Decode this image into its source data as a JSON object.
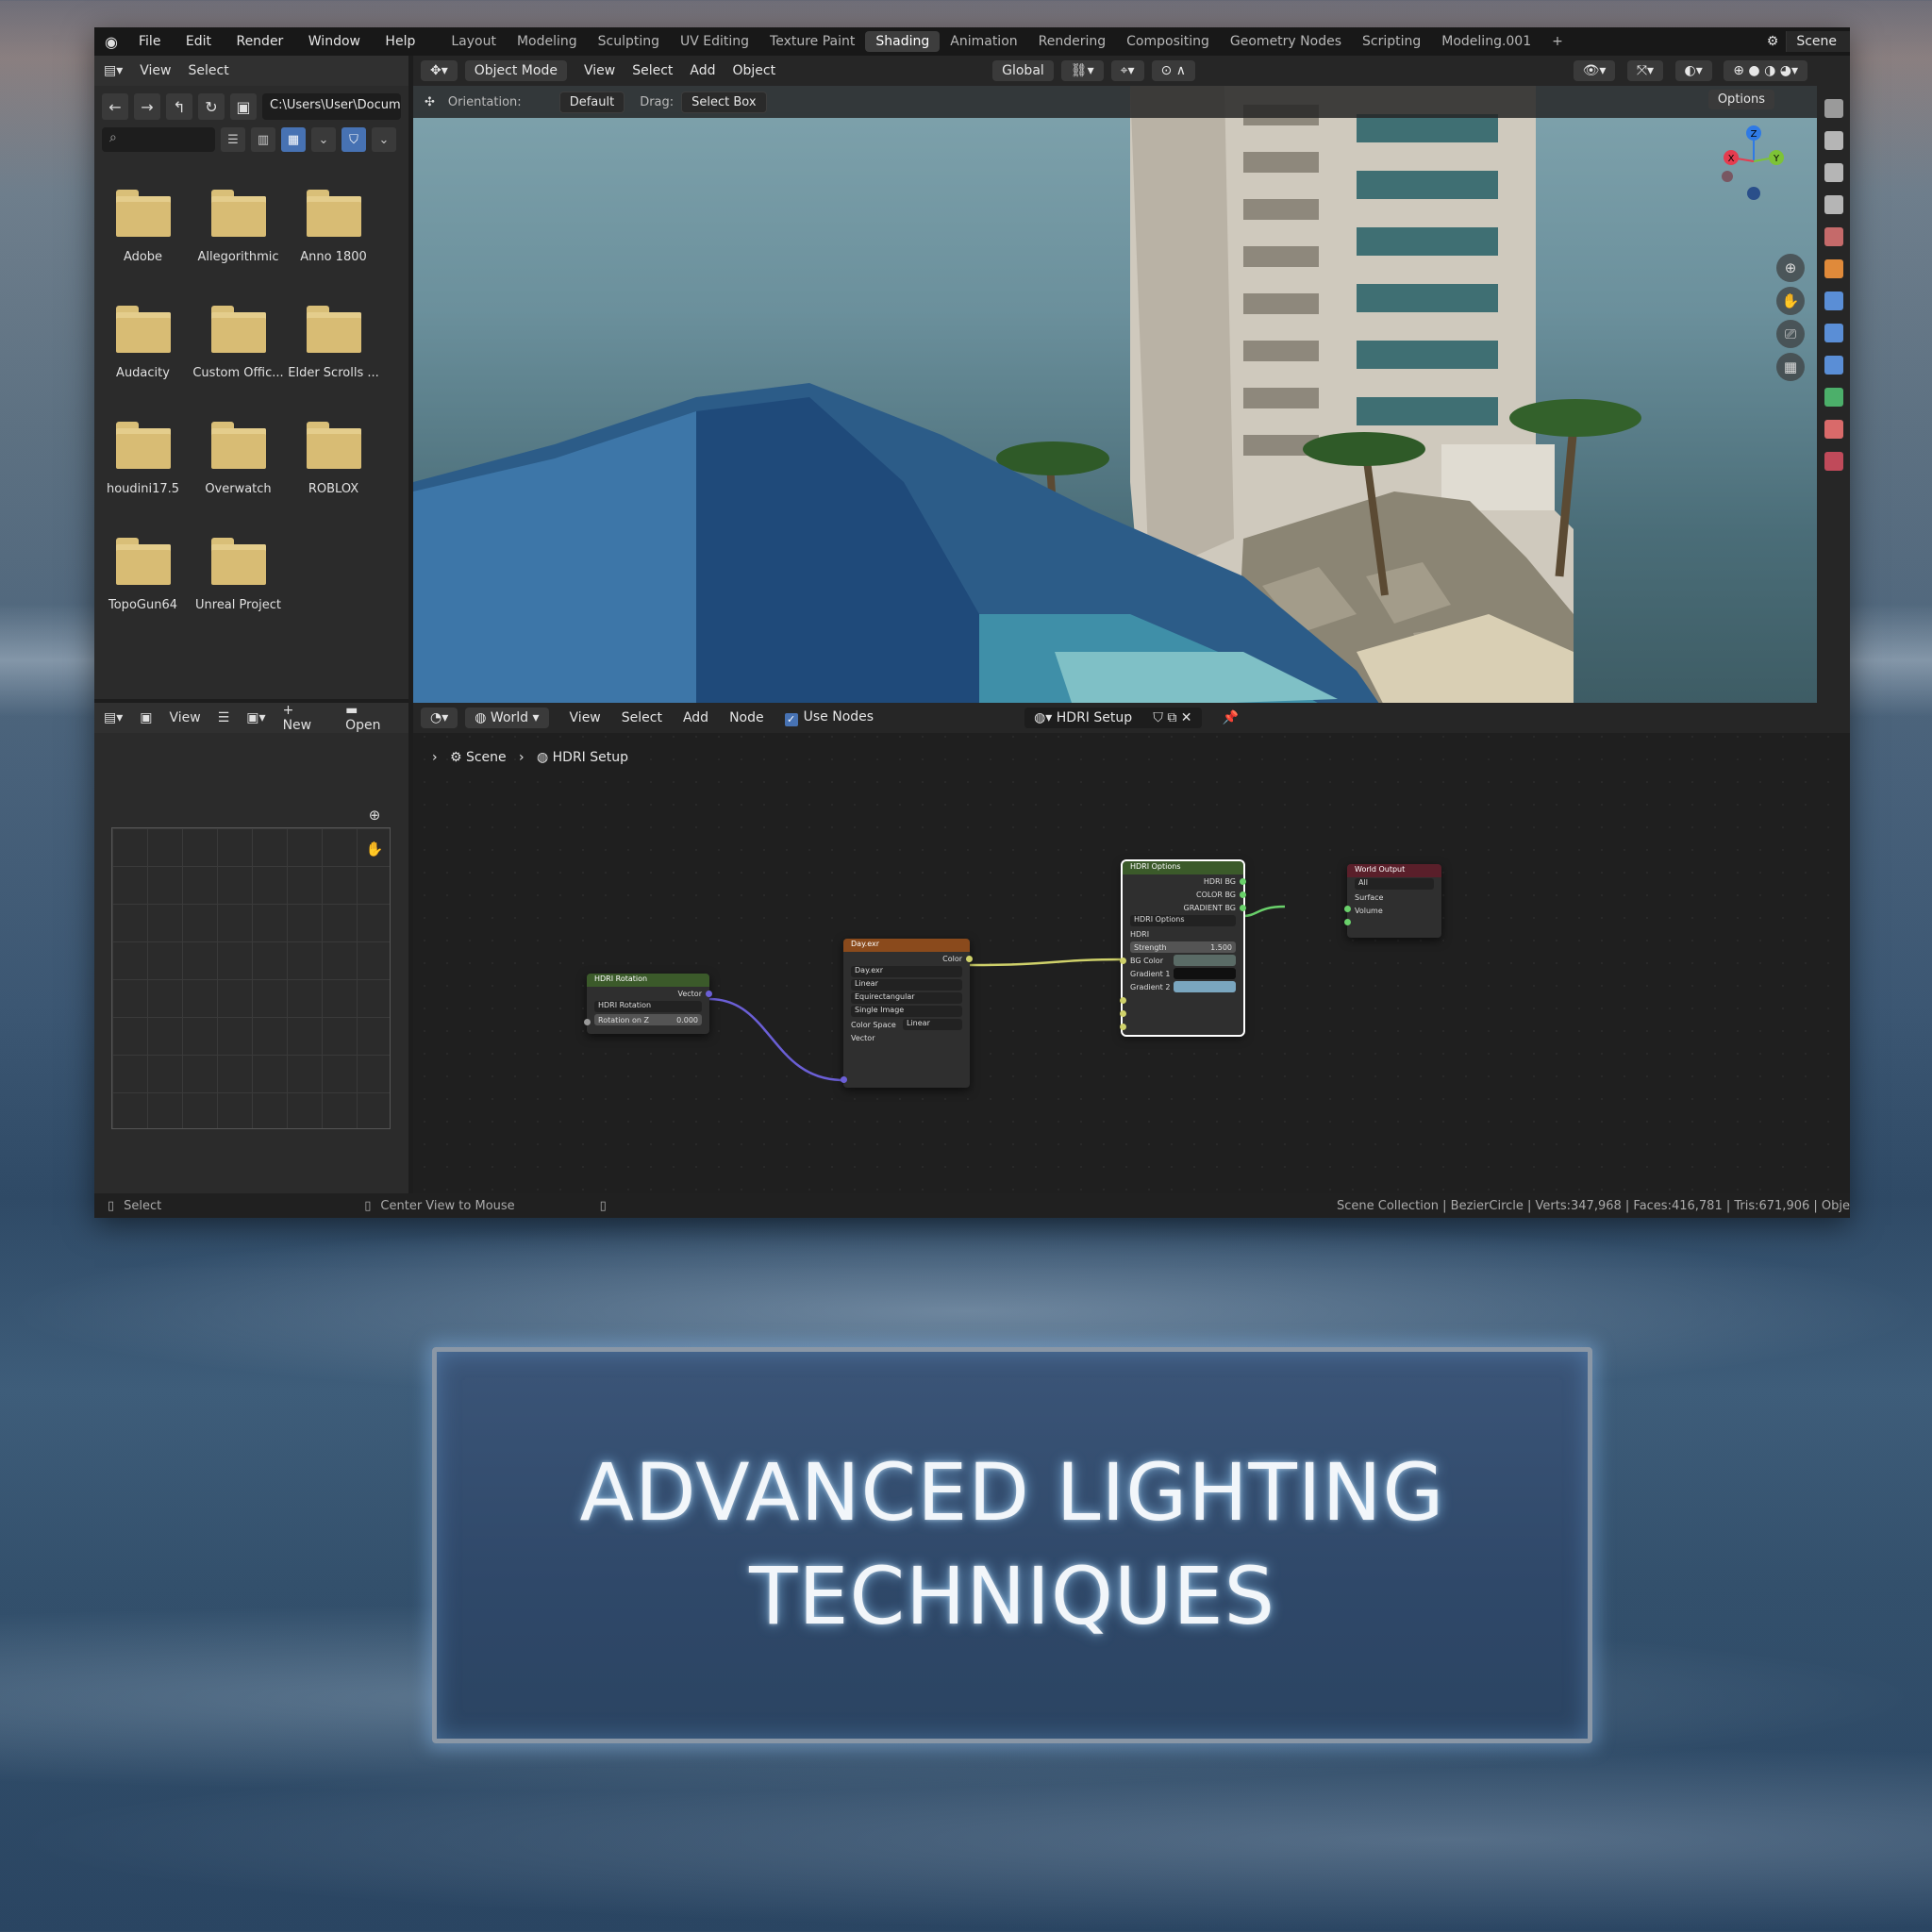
{
  "topbar": {
    "menus": [
      "File",
      "Edit",
      "Render",
      "Window",
      "Help"
    ],
    "workspaces": [
      "Layout",
      "Modeling",
      "Sculpting",
      "UV Editing",
      "Texture Paint",
      "Shading",
      "Animation",
      "Rendering",
      "Compositing",
      "Geometry Nodes",
      "Scripting",
      "Modeling.001"
    ],
    "active_workspace": "Shading",
    "add_tab": "+",
    "scene_name": "Scene"
  },
  "file_browser": {
    "header_items": [
      "View",
      "Select"
    ],
    "path": "C:\\Users\\User\\Docum...",
    "folders": [
      "Adobe",
      "Allegorithmic",
      "Anno 1800",
      "Audacity",
      "Custom Offic...",
      "Elder Scrolls ...",
      "houdini17.5",
      "Overwatch",
      "ROBLOX",
      "TopoGun64",
      "Unreal Project"
    ]
  },
  "viewport": {
    "mode": "Object Mode",
    "menus": [
      "View",
      "Select",
      "Add",
      "Object"
    ],
    "transform": "Global",
    "orientation_label": "Orientation:",
    "orientation_value": "Default",
    "drag_label": "Drag:",
    "drag_value": "Select Box",
    "options_label": "Options",
    "gizmo_axes": {
      "x": "X",
      "y": "Y",
      "z": "Z"
    }
  },
  "image_editor": {
    "view_label": "View",
    "new_label": "New",
    "open_label": "Open"
  },
  "node_editor": {
    "type": "World",
    "menus": [
      "View",
      "Select",
      "Add",
      "Node"
    ],
    "use_nodes_label": "Use Nodes",
    "nodetree": "HDRI Setup",
    "breadcrumb": [
      "Scene",
      "HDRI Setup"
    ],
    "nodes": {
      "rotation": {
        "title": "HDRI Rotation",
        "out": "Vector",
        "group": "HDRI Rotation",
        "field_label": "Rotation on Z",
        "field_value": "0.000"
      },
      "image": {
        "title": "Day.exr",
        "out": "Color",
        "image": "Day.exr",
        "interp": "Linear",
        "proj": "Equirectangular",
        "source": "Single Image",
        "cs_label": "Color Space",
        "cs_value": "Linear",
        "in": "Vector"
      },
      "options": {
        "title": "HDRI Options",
        "outs": [
          "HDRI BG",
          "COLOR BG",
          "GRADIENT BG"
        ],
        "group": "HDRI Options",
        "in_hdri": "HDRI",
        "strength_label": "Strength",
        "strength_value": "1.500",
        "bg_color": "BG Color",
        "grad1": "Gradient 1",
        "grad2": "Gradient 2"
      },
      "output": {
        "title": "World Output",
        "target": "All",
        "surface": "Surface",
        "volume": "Volume"
      }
    },
    "colors": {
      "grad1": "#101010",
      "grad2": "#7aa6bf",
      "bgcolor": "#5a6b66"
    }
  },
  "status": {
    "left": "Select",
    "middle": "Center View to Mouse",
    "right": "Scene Collection | BezierCircle | Verts:347,968 | Faces:416,781 | Tris:671,906 | Obje"
  },
  "banner": {
    "line1": "ADVANCED LIGHTING",
    "line2": "TECHNIQUES"
  },
  "icons": [
    "blender-logo",
    "folder-icon",
    "back-icon",
    "forward-icon",
    "parent-icon",
    "refresh-icon",
    "new-folder-icon",
    "search-icon",
    "filter-icon",
    "zoom-icon",
    "hand-icon",
    "camera-icon",
    "grid-icon",
    "world-icon",
    "pin-icon"
  ]
}
